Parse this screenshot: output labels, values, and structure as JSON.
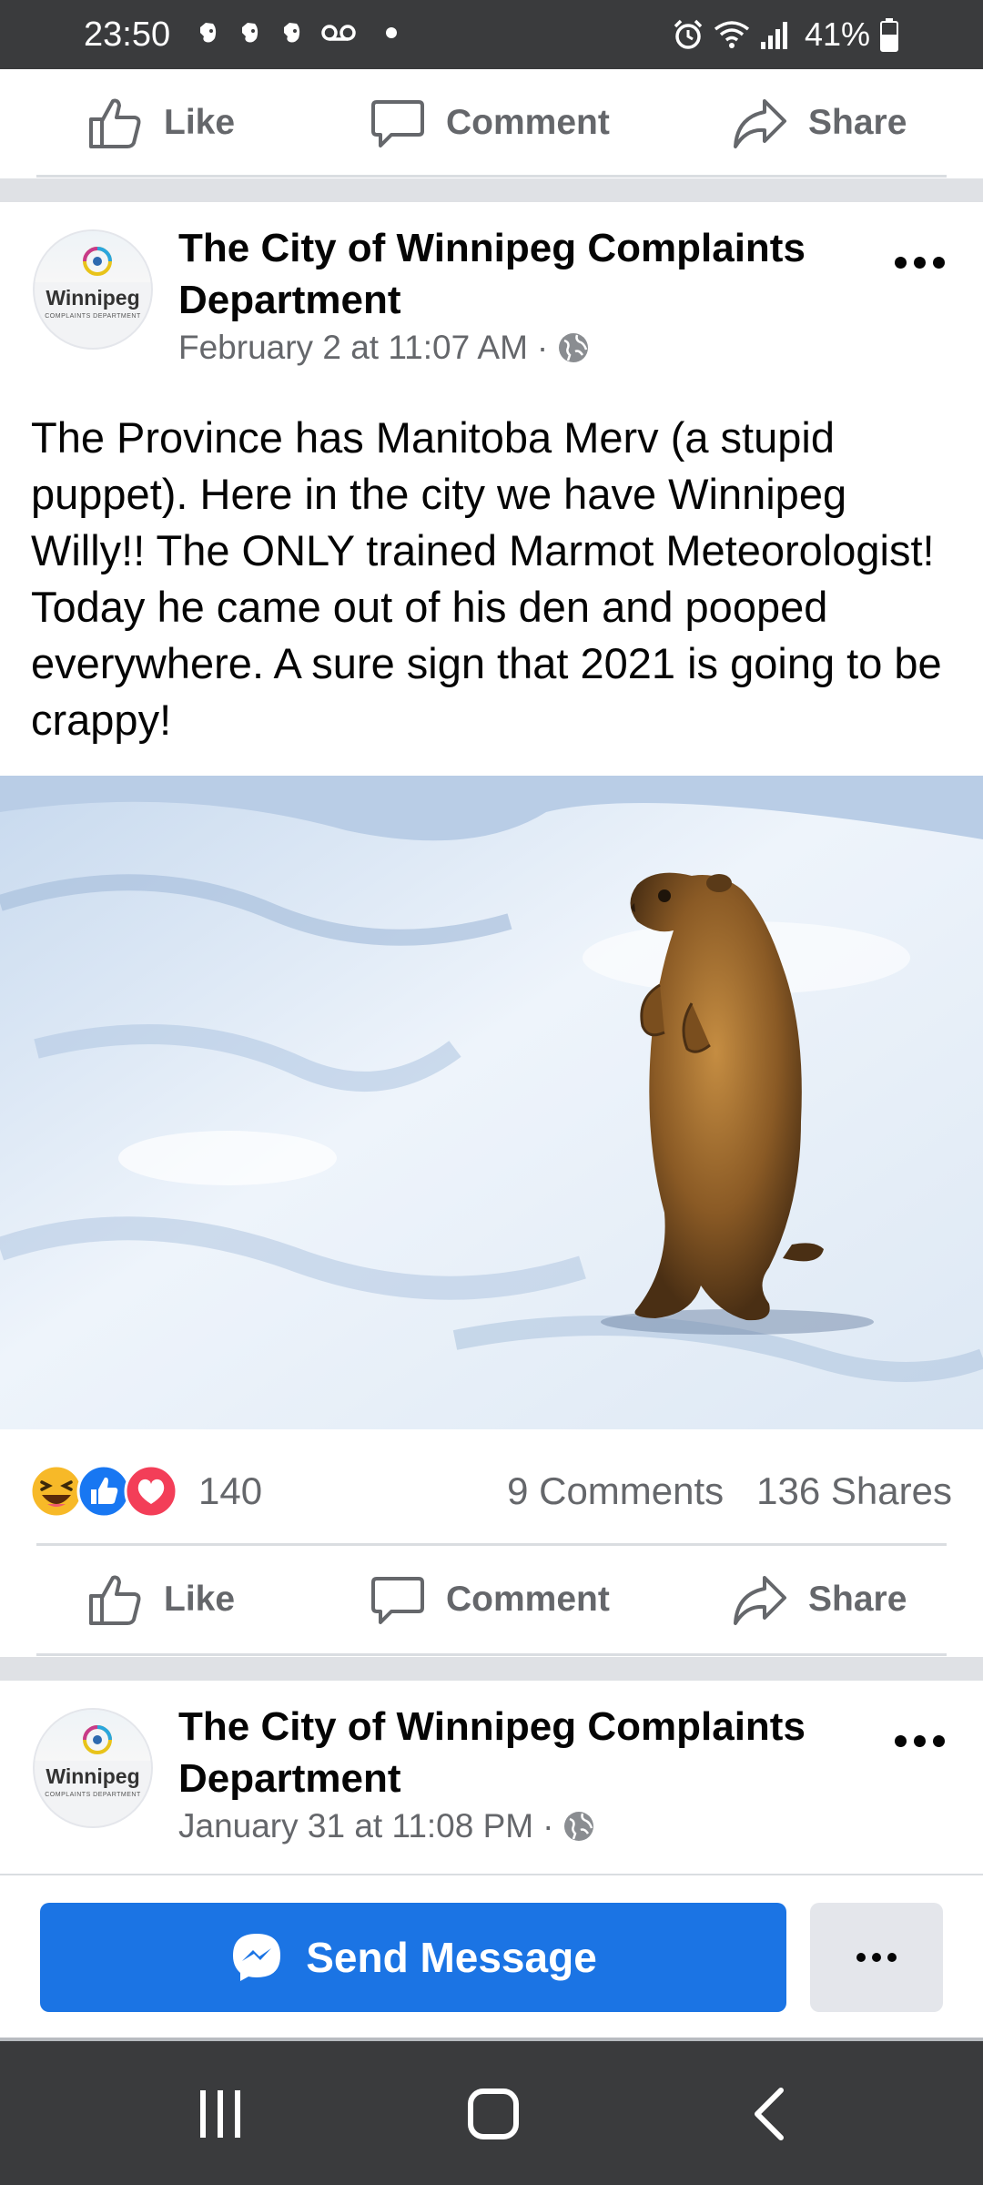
{
  "status_bar": {
    "time": "23:50",
    "notification_icons": [
      "evernote-icon",
      "evernote-icon",
      "evernote-icon",
      "voicemail-icon",
      "dot-icon"
    ],
    "system_icons": [
      "alarm-icon",
      "wifi-icon",
      "signal-icon",
      "battery-icon"
    ],
    "battery": "41%"
  },
  "actions": {
    "like": "Like",
    "comment": "Comment",
    "share": "Share"
  },
  "post1": {
    "page_name": "The City of Winnipeg Complaints Department",
    "timestamp": "February 2 at 11:07 AM",
    "separator": "·",
    "avatar_word": "Winnipeg",
    "avatar_sub": "COMPLAINTS DEPARTMENT",
    "text": "The Province has Manitoba Merv (a stupid puppet). Here in the city we have Winnipeg Willy!! The ONLY trained Marmot Meteorologist! Today he came out of his den and pooped everywhere. A sure sign that 2021 is going to be crappy!",
    "reaction_icons": [
      "haha-icon",
      "like-icon",
      "love-icon"
    ],
    "reaction_count": "140",
    "comments": "9 Comments",
    "shares": "136 Shares"
  },
  "post2": {
    "page_name": "The City of Winnipeg Complaints Department",
    "timestamp": "January 31 at 11:08 PM",
    "separator": "·",
    "avatar_word": "Winnipeg",
    "avatar_sub": "COMPLAINTS DEPARTMENT"
  },
  "message_bar": {
    "send_label": "Send Message"
  },
  "colors": {
    "brand_blue": "#1b74e4",
    "meta_gray": "#65676b",
    "status_bar": "#3a3b3d"
  }
}
